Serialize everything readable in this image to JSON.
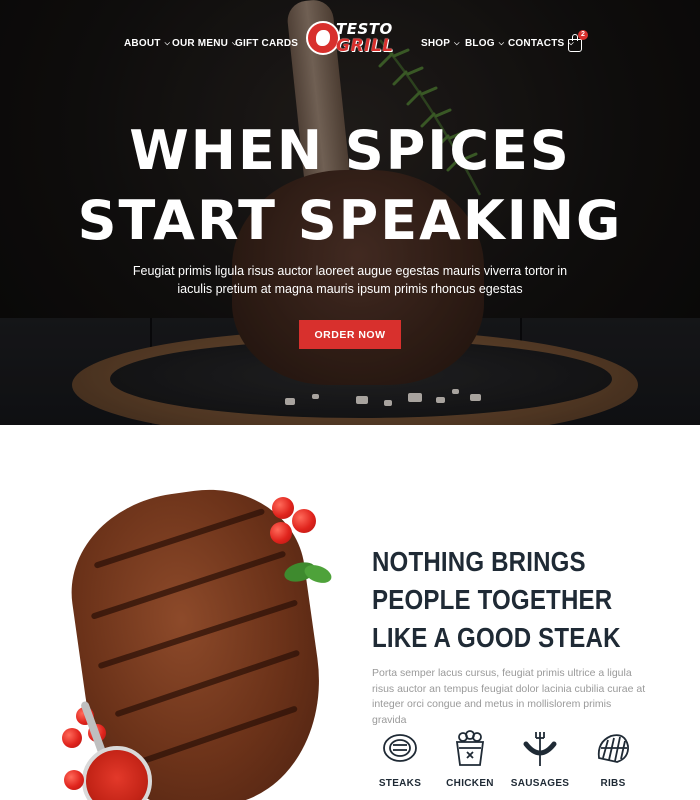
{
  "nav": {
    "left_items": [
      {
        "label": "ABOUT",
        "has_dropdown": true
      },
      {
        "label": "OUR MENU",
        "has_dropdown": true
      },
      {
        "label": "GIFT CARDS",
        "has_dropdown": false
      }
    ],
    "right_items": [
      {
        "label": "SHOP",
        "has_dropdown": true
      },
      {
        "label": "BLOG",
        "has_dropdown": true
      },
      {
        "label": "CONTACTS",
        "has_dropdown": true
      }
    ],
    "logo": {
      "line1": "TESTO",
      "line2": "GRILL"
    },
    "cart": {
      "count": "2",
      "icon": "shopping-bag-icon"
    }
  },
  "hero": {
    "title_line1": "WHEN SPICES",
    "title_line2": "START SPEAKING",
    "subtitle": "Feugiat primis ligula risus auctor laoreet augue egestas mauris viverra tortor in iaculis pretium at magna mauris ipsum primis rhoncus egestas",
    "cta_label": "ORDER NOW"
  },
  "about": {
    "title": "NOTHING BRINGS PEOPLE TOGETHER LIKE A GOOD STEAK",
    "body": "Porta semper lacus cursus, feugiat primis ultrice a ligula risus auctor an tempus feugiat dolor lacinia cubilia curae at integer orci congue and metus in mollislorem primis gravida",
    "categories": [
      {
        "label": "STEAKS",
        "icon": "steak-icon"
      },
      {
        "label": "CHICKEN",
        "icon": "chicken-bucket-icon"
      },
      {
        "label": "SAUSAGES",
        "icon": "sausage-fork-icon"
      },
      {
        "label": "RIBS",
        "icon": "ribs-icon"
      }
    ]
  },
  "colors": {
    "accent": "#d8302d",
    "heading": "#1f2a35",
    "body_text": "#9a9a9a",
    "hero_bg": "#141211"
  }
}
